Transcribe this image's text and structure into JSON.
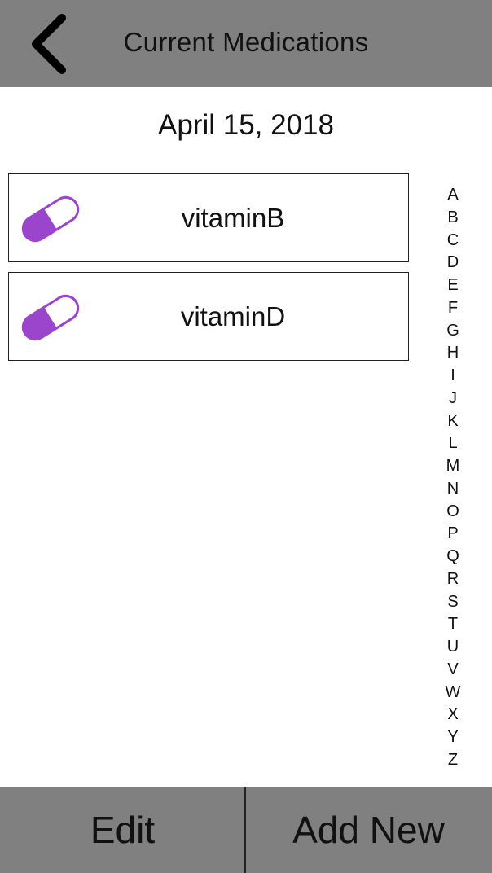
{
  "header": {
    "title": "Current Medications",
    "back_icon": "chevron-left-icon"
  },
  "date": "April 15, 2018",
  "medications": [
    {
      "name": "vitaminB",
      "icon": "pill-capsule-icon"
    },
    {
      "name": "vitaminD",
      "icon": "pill-capsule-icon"
    }
  ],
  "alphabet_index": [
    "A",
    "B",
    "C",
    "D",
    "E",
    "F",
    "G",
    "H",
    "I",
    "J",
    "K",
    "L",
    "M",
    "N",
    "O",
    "P",
    "Q",
    "R",
    "S",
    "T",
    "U",
    "V",
    "W",
    "X",
    "Y",
    "Z"
  ],
  "footer": {
    "edit_label": "Edit",
    "add_label": "Add New"
  },
  "colors": {
    "bar_gray": "#808080",
    "pill_purple": "#9b44cc",
    "text": "#111111"
  }
}
